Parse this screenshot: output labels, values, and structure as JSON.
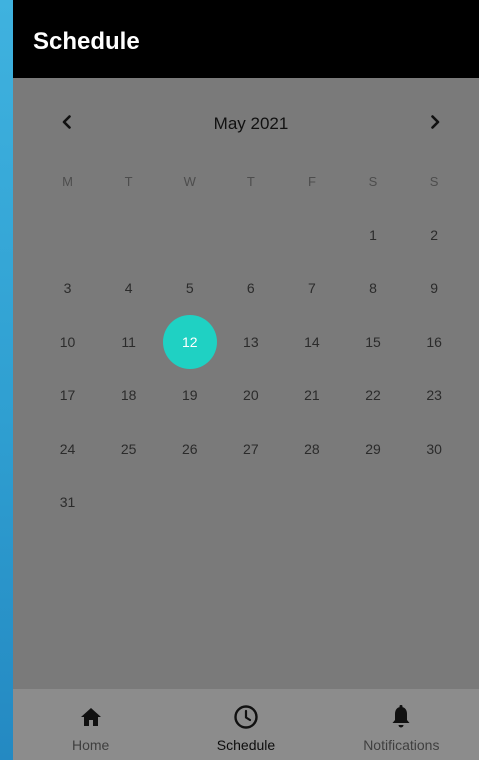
{
  "app_bar": {
    "title": "Schedule"
  },
  "calendar": {
    "month_label": "May 2021",
    "prev_icon": "chevron-left-icon",
    "next_icon": "chevron-right-icon",
    "weekdays": [
      "M",
      "T",
      "W",
      "T",
      "F",
      "S",
      "S"
    ],
    "leading_blanks": 5,
    "days": [
      "1",
      "2",
      "3",
      "4",
      "5",
      "6",
      "7",
      "8",
      "9",
      "10",
      "11",
      "12",
      "13",
      "14",
      "15",
      "16",
      "17",
      "18",
      "19",
      "20",
      "21",
      "22",
      "23",
      "24",
      "25",
      "26",
      "27",
      "28",
      "29",
      "30",
      "31"
    ],
    "selected_day": "12",
    "selected_color": "#1fd1c3"
  },
  "bottom_nav": {
    "items": [
      {
        "label": "Home",
        "icon": "home-icon",
        "active": false
      },
      {
        "label": "Schedule",
        "icon": "clock-icon",
        "active": true
      },
      {
        "label": "Notifications",
        "icon": "bell-icon",
        "active": false
      }
    ]
  },
  "colors": {
    "app_bar_bg": "#000000",
    "content_bg": "#7a7a7a",
    "bottom_nav_bg": "#8c8c8c",
    "page_bg": "#3fb2df"
  }
}
